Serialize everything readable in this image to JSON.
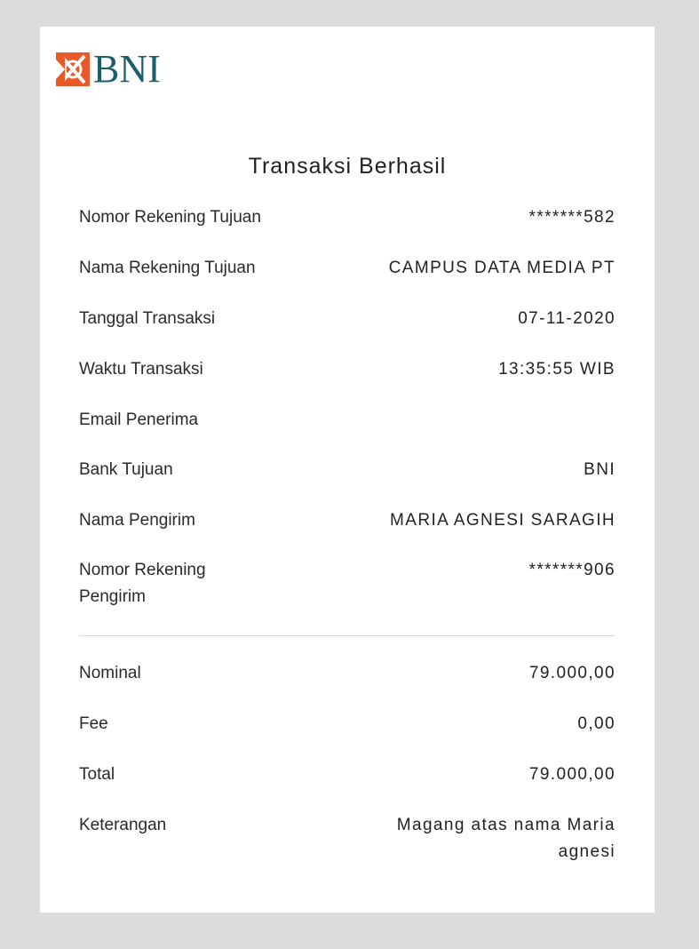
{
  "brand": {
    "logo_text": "BNI",
    "logo_icon": "bni-emblem-icon",
    "primary_color": "#1b5f6b",
    "accent_color": "#e8592a"
  },
  "receipt": {
    "title": "Transaksi Berhasil",
    "details": [
      {
        "label": "Nomor Rekening Tujuan",
        "value": "*******582"
      },
      {
        "label": "Nama Rekening Tujuan",
        "value": "CAMPUS DATA MEDIA PT"
      },
      {
        "label": "Tanggal Transaksi",
        "value": "07-11-2020"
      },
      {
        "label": "Waktu Transaksi",
        "value": "13:35:55 WIB"
      },
      {
        "label": "Email Penerima",
        "value": ""
      },
      {
        "label": "Bank Tujuan",
        "value": "BNI"
      },
      {
        "label": "Nama Pengirim",
        "value": "MARIA AGNESI SARAGIH"
      },
      {
        "label": "Nomor Rekening Pengirim",
        "value": "*******906"
      }
    ],
    "amounts": [
      {
        "label": "Nominal",
        "value": "79.000,00"
      },
      {
        "label": "Fee",
        "value": "0,00"
      },
      {
        "label": "Total",
        "value": "79.000,00"
      },
      {
        "label": "Keterangan",
        "value": "Magang atas nama Maria agnesi"
      }
    ]
  }
}
